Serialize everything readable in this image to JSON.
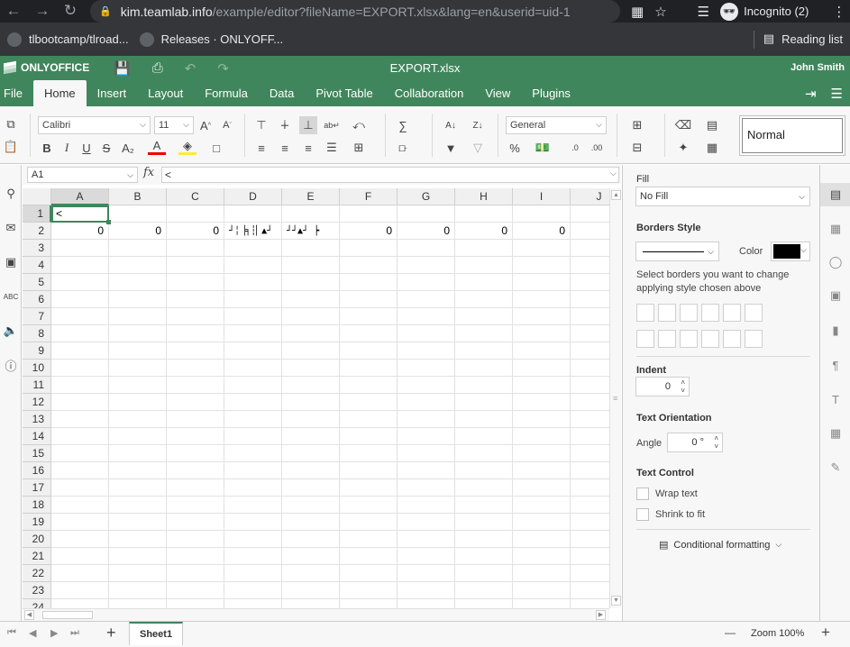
{
  "browser": {
    "url_host": "kim.teamlab.info",
    "url_rest": "/example/editor?fileName=EXPORT.xlsx&lang=en&userid=uid-1",
    "incognito_label": "Incognito (2)",
    "bookmarks": [
      "tlbootcamp/tlroad...",
      "Releases · ONLYOFF..."
    ],
    "reading_list": "Reading list"
  },
  "app": {
    "brand": "ONLYOFFICE",
    "doc_title": "EXPORT.xlsx",
    "user": "John Smith",
    "tabs": [
      "File",
      "Home",
      "Insert",
      "Layout",
      "Formula",
      "Data",
      "Pivot Table",
      "Collaboration",
      "View",
      "Plugins"
    ],
    "active_tab": "Home"
  },
  "toolbar": {
    "font_name": "Calibri",
    "font_size": "11",
    "number_format": "General",
    "cell_style": "Normal",
    "bold": "B",
    "italic": "I",
    "underline": "U",
    "strike": "S",
    "subscript": "A₂",
    "font_color": "A",
    "increase_font": "A",
    "decrease_font": "A",
    "percent": "%",
    "decimal_decrease": ".0",
    "decimal_increase": ".00"
  },
  "formula_bar": {
    "cell_ref": "A1",
    "fx": "fx",
    "content": "<"
  },
  "sheet": {
    "columns": [
      "A",
      "B",
      "C",
      "D",
      "E",
      "F",
      "G",
      "H",
      "I",
      "J"
    ],
    "rows": [
      "1",
      "2",
      "3",
      "4",
      "5",
      "6",
      "7",
      "8",
      "9",
      "10",
      "11",
      "12",
      "13",
      "14",
      "15",
      "16",
      "17",
      "18",
      "19",
      "20",
      "21",
      "22",
      "23",
      "24"
    ],
    "cells": {
      "A1": "<",
      "A2": "0",
      "B2": "0",
      "C2": "0",
      "D2": "┘╎▕╕┆▏▲┘",
      "E2": "┘┘▲┘ ┝",
      "F2": "0",
      "G2": "0",
      "H2": "0",
      "I2": "0"
    }
  },
  "right_panel": {
    "fill_label": "Fill",
    "fill_value": "No Fill",
    "borders_label": "Borders Style",
    "color_label": "Color",
    "border_color": "#000000",
    "borders_help": "Select borders you want to change applying style chosen above",
    "indent_label": "Indent",
    "indent_value": "0",
    "orientation_label": "Text Orientation",
    "angle_label": "Angle",
    "angle_value": "0 °",
    "text_control_label": "Text Control",
    "wrap_text": "Wrap text",
    "shrink_to_fit": "Shrink to fit",
    "conditional_formatting": "Conditional formatting"
  },
  "status": {
    "sheet_name": "Sheet1",
    "zoom": "Zoom 100%",
    "zoom_out": "—",
    "zoom_in": "+",
    "add_sheet": "+"
  },
  "colors": {
    "accent": "#40865c",
    "chrome_dark": "#202124"
  }
}
